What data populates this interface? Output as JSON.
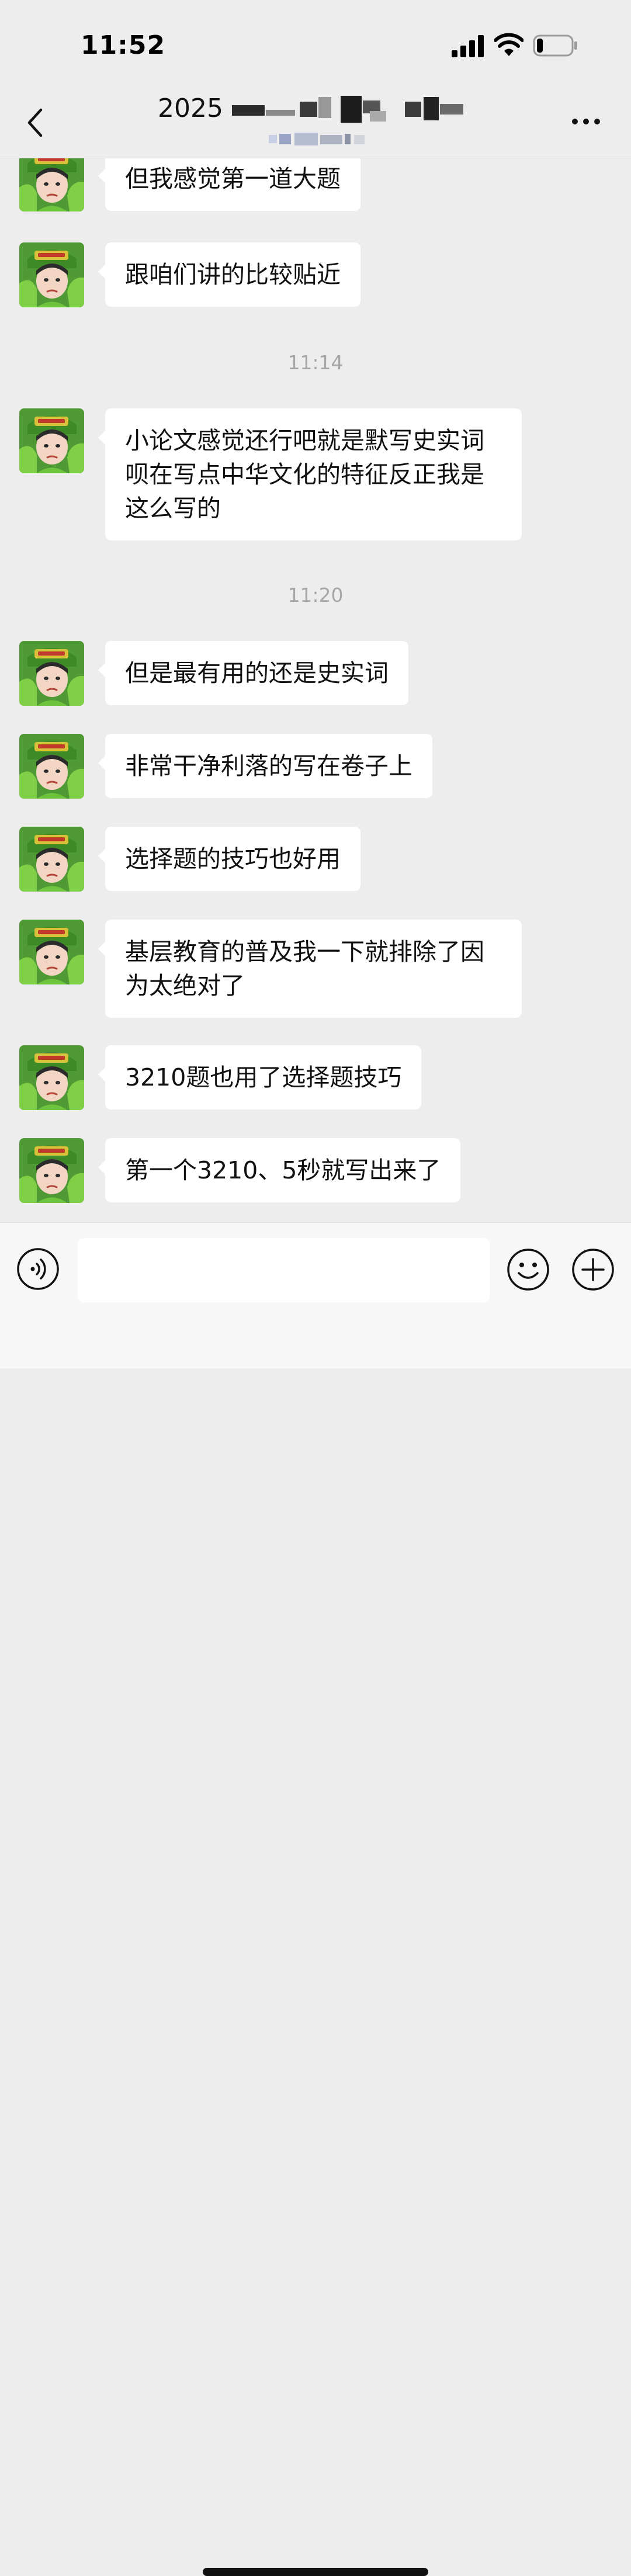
{
  "status_bar": {
    "time": "11:52",
    "battery_level": 0.18
  },
  "header": {
    "title": "2025"
  },
  "composer": {
    "placeholder": ""
  },
  "icons": {
    "back": "chevron-left-icon",
    "more": "more-dots-icon",
    "voice": "voice-icon",
    "emoji": "emoji-icon",
    "plus": "plus-icon",
    "avatar": "avatar"
  },
  "colors": {
    "background": "#ededed",
    "bubble": "#ffffff",
    "timestamp": "#a6a6a6",
    "avatar_green": "#5aa83a"
  },
  "messages": [
    {
      "type": "text",
      "text": "但我感觉第一道大题"
    },
    {
      "type": "text",
      "text": "跟咱们讲的比较贴近"
    },
    {
      "type": "time",
      "text": "11:14"
    },
    {
      "type": "text",
      "text": "小论文感觉还行吧就是默写史实词呗在写点中华文化的特征反正我是这么写的"
    },
    {
      "type": "time",
      "text": "11:20"
    },
    {
      "type": "text",
      "text": "但是最有用的还是史实词"
    },
    {
      "type": "text",
      "text": "非常干净利落的写在卷子上"
    },
    {
      "type": "text",
      "text": "选择题的技巧也好用"
    },
    {
      "type": "text",
      "text": "基层教育的普及我一下就排除了因为太绝对了"
    },
    {
      "type": "text",
      "text": "3210题也用了选择题技巧"
    },
    {
      "type": "text",
      "text": "第一个3210、5秒就写出来了"
    }
  ]
}
